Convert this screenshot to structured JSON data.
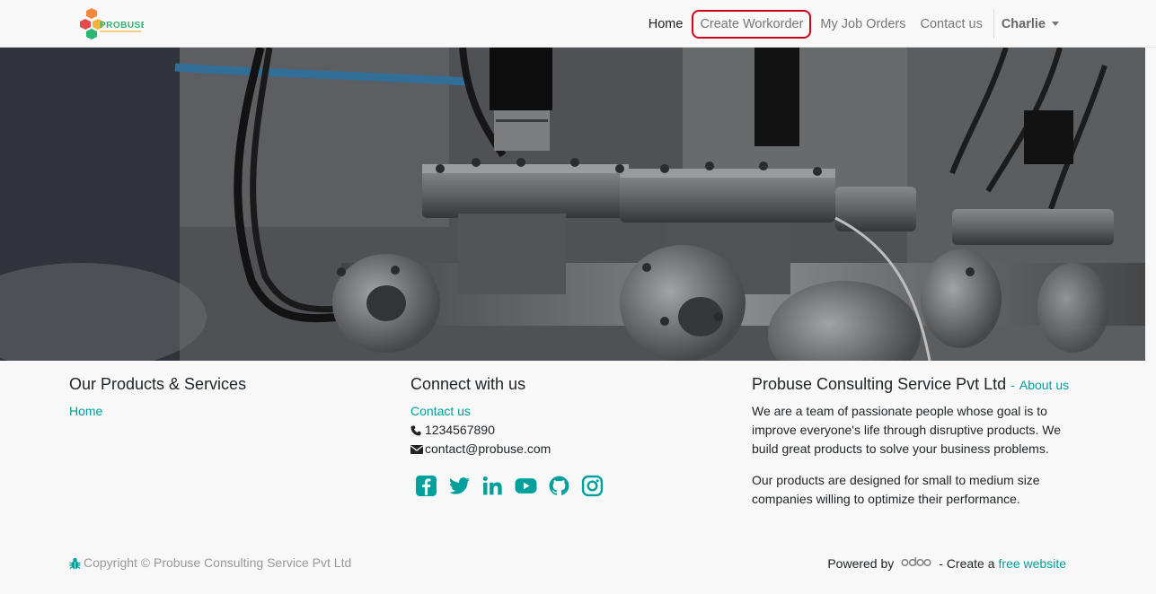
{
  "header": {
    "logo_text": "PROBUSE",
    "nav": [
      {
        "label": "Home"
      },
      {
        "label": "Create Workorder"
      },
      {
        "label": "My Job Orders"
      },
      {
        "label": "Contact us"
      }
    ],
    "user": "Charlie"
  },
  "footer": {
    "col1": {
      "title": "Our Products & Services",
      "link": "Home"
    },
    "col2": {
      "title": "Connect with us",
      "contact_link": "Contact us",
      "phone": "1234567890",
      "email": "contact@probuse.com",
      "social_icons": [
        "facebook-icon",
        "twitter-icon",
        "linkedin-icon",
        "youtube-icon",
        "github-icon",
        "instagram-icon"
      ]
    },
    "col3": {
      "title": "Probuse Consulting Service Pvt Ltd",
      "dash": "-",
      "about_link": "About us",
      "para1": "We are a team of passionate people whose goal is to improve everyone's life through disruptive products. We build great products to solve your business problems.",
      "para2": "Our products are designed for small to medium size companies willing to optimize their performance."
    },
    "copyright": "Copyright © Probuse Consulting Service Pvt Ltd",
    "powered_by": "Powered by",
    "create_a": "- Create a",
    "free_website": "free website"
  },
  "colors": {
    "accent": "#00a09d",
    "highlight_border": "#d0021b"
  }
}
